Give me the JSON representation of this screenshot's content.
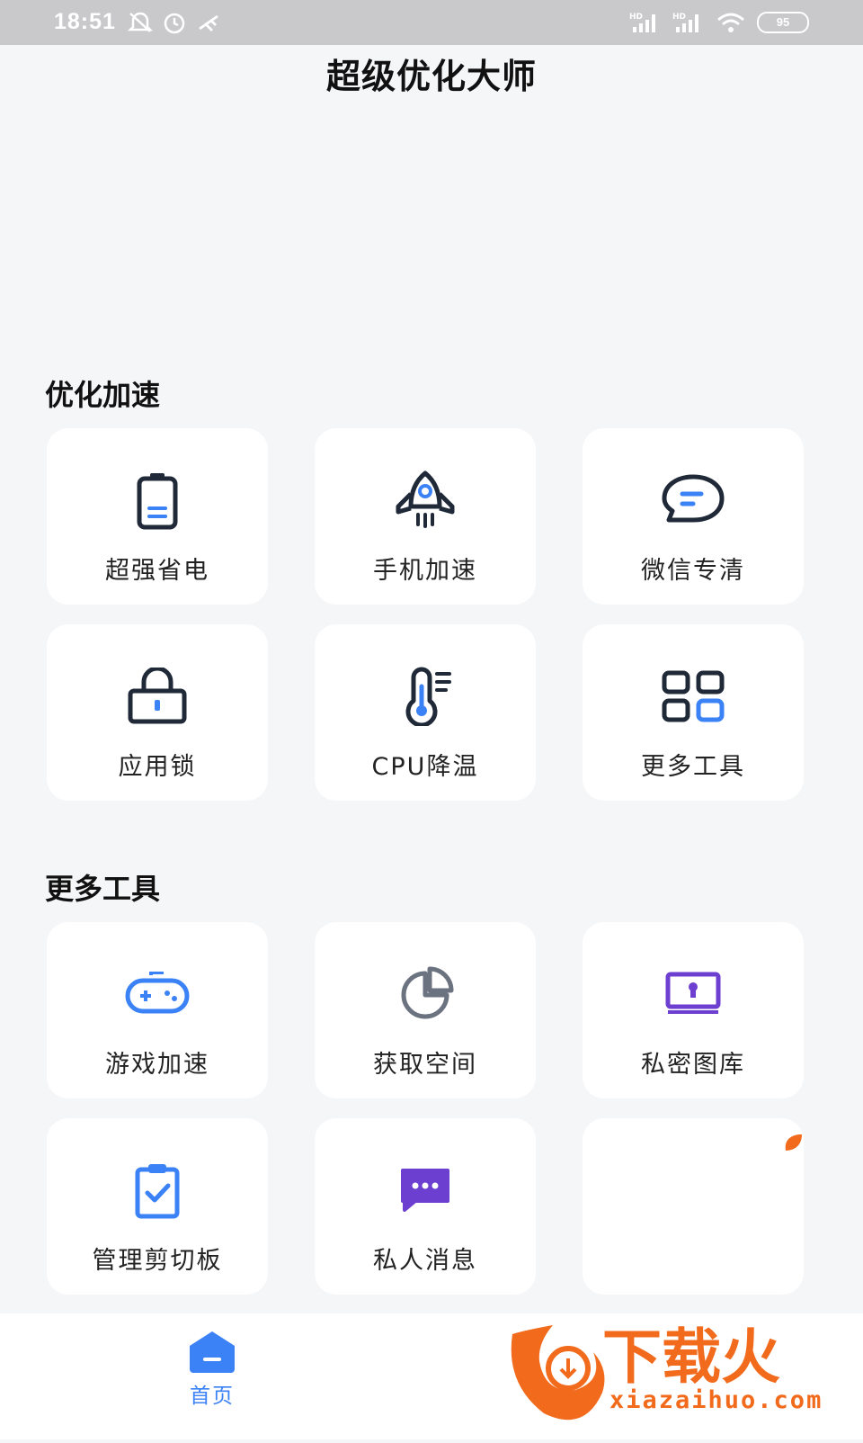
{
  "status_bar": {
    "time": "18:51",
    "battery": "95",
    "left_icons": [
      "mute-icon",
      "alarm-icon",
      "usb-icon"
    ],
    "right_icons": [
      "signal-hd-1-icon",
      "signal-hd-2-icon",
      "wifi-icon"
    ]
  },
  "app": {
    "title": "超级优化大师"
  },
  "sections": [
    {
      "title": "优化加速",
      "items": [
        {
          "label": "超强省电",
          "icon": "battery-icon"
        },
        {
          "label": "手机加速",
          "icon": "rocket-icon"
        },
        {
          "label": "微信专清",
          "icon": "chat-bubble-icon"
        },
        {
          "label": "应用锁",
          "icon": "lock-icon"
        },
        {
          "label": "CPU降温",
          "icon": "thermometer-icon"
        },
        {
          "label": "更多工具",
          "icon": "grid-icon"
        }
      ]
    },
    {
      "title": "更多工具",
      "items": [
        {
          "label": "游戏加速",
          "icon": "gamepad-icon"
        },
        {
          "label": "获取空间",
          "icon": "pie-chart-icon"
        },
        {
          "label": "私密图库",
          "icon": "private-gallery-icon"
        },
        {
          "label": "管理剪切板",
          "icon": "clipboard-icon"
        },
        {
          "label": "私人消息",
          "icon": "message-icon"
        },
        {
          "label": "",
          "icon": "leaf-icon"
        }
      ]
    }
  ],
  "bottom_nav": {
    "home_label": "首页"
  },
  "watermark": {
    "text": "下载火",
    "url": "xiazaihuo.com"
  },
  "colors": {
    "accent": "#3b82f6",
    "purple": "#6d3fd0",
    "dark": "#1f2937",
    "orange": "#f26a1b"
  }
}
